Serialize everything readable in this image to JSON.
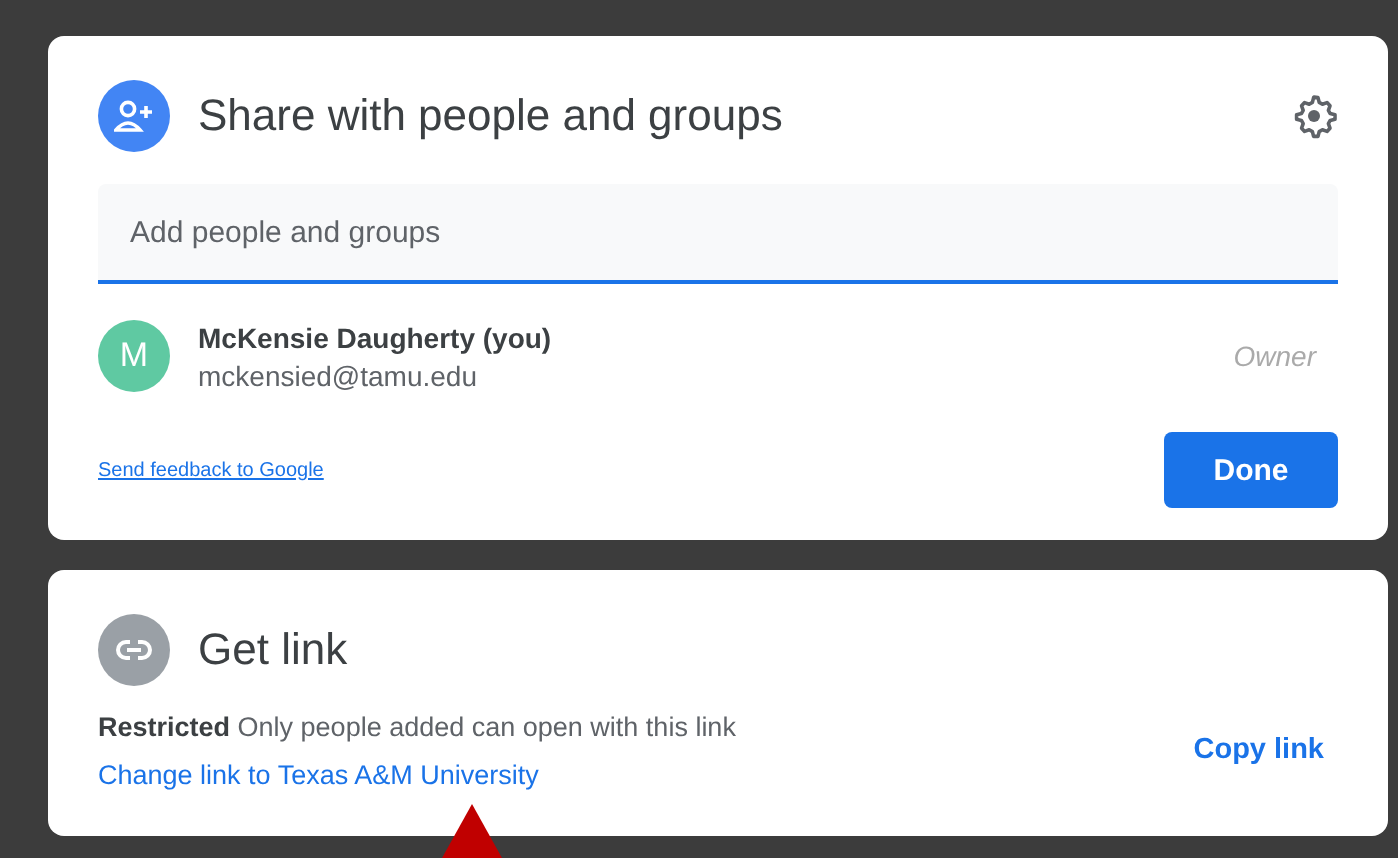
{
  "share": {
    "title": "Share with people and groups",
    "search": {
      "placeholder": "Add people and groups"
    },
    "people": [
      {
        "initial": "M",
        "name": "McKensie Daugherty (you)",
        "email": "mckensied@tamu.edu",
        "role": "Owner",
        "color": "#5fc9a2"
      }
    ],
    "feedback_link": "Send feedback to Google",
    "done_button": "Done"
  },
  "get_link": {
    "title": "Get link",
    "access": "**Restricted** Only people added can open with this link",
    "change_link": "Change link to Texas A&M University",
    "copy_button": "Copy link"
  }
}
